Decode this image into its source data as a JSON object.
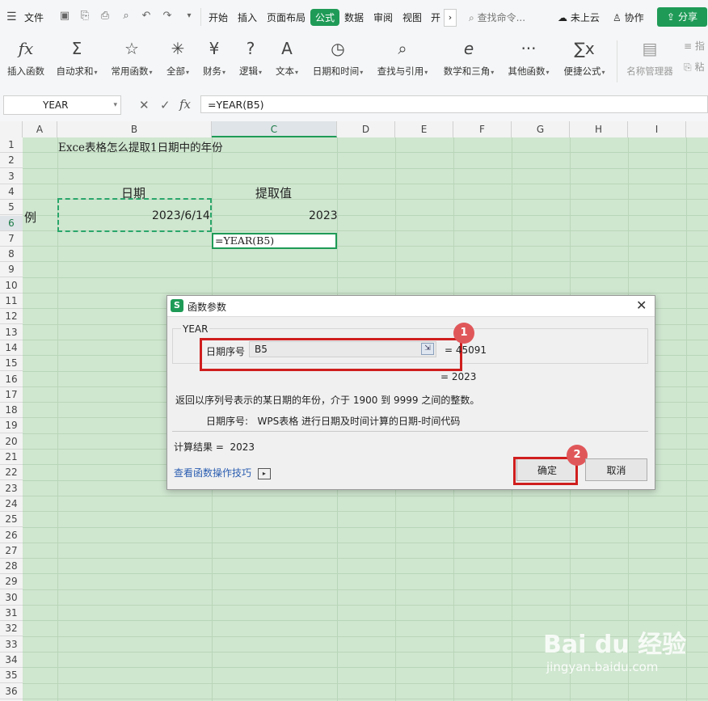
{
  "menubar": {
    "file_label": "文件",
    "tabs": [
      "开始",
      "插入",
      "页面布局",
      "公式",
      "数据",
      "审阅",
      "视图",
      "开"
    ],
    "active_tab": "公式",
    "search_placeholder": "查找命令...",
    "cloud_label": "未上云",
    "collab_label": "协作",
    "share_label": "分享"
  },
  "ribbon": {
    "buttons": [
      {
        "label": "插入函数",
        "icon": "fx"
      },
      {
        "label": "自动求和",
        "icon": "Σ"
      },
      {
        "label": "常用函数",
        "icon": "☆"
      },
      {
        "label": "全部",
        "icon": "✳"
      },
      {
        "label": "财务",
        "icon": "¥"
      },
      {
        "label": "逻辑",
        "icon": "?"
      },
      {
        "label": "文本",
        "icon": "A"
      },
      {
        "label": "日期和时间",
        "icon": "◷"
      },
      {
        "label": "查找与引用",
        "icon": "⌕"
      },
      {
        "label": "数学和三角",
        "icon": "e"
      },
      {
        "label": "其他函数",
        "icon": "···"
      },
      {
        "label": "便捷公式",
        "icon": "∑x"
      },
      {
        "label": "名称管理器",
        "icon": "▤"
      },
      {
        "label": "指",
        "icon": "≡"
      },
      {
        "label": "粘",
        "icon": "⎘"
      }
    ]
  },
  "formula_bar": {
    "name_box": "YEAR",
    "fx_label": "fx",
    "formula": "=YEAR(B5)"
  },
  "grid": {
    "columns": [
      "A",
      "B",
      "C",
      "D",
      "E",
      "F",
      "G",
      "H",
      "I"
    ],
    "selected_column": "C",
    "selected_row": "6",
    "rows": [
      "1",
      "2",
      "3",
      "4",
      "5",
      "6",
      "7",
      "8",
      "9",
      "10",
      "11",
      "12",
      "13",
      "14",
      "15",
      "16",
      "17",
      "18",
      "19",
      "20",
      "21",
      "22",
      "23",
      "24",
      "25",
      "26",
      "27",
      "28",
      "29",
      "30",
      "31",
      "32",
      "33",
      "34",
      "35",
      "36"
    ],
    "cells": {
      "b1": "Exce表格怎么提取1日期中的年份",
      "b4": "日期",
      "c4": "提取值",
      "a5": "例",
      "b5": "2023/6/14",
      "c5": "2023",
      "c6": "=YEAR(B5)"
    }
  },
  "dialog": {
    "title": "函数参数",
    "function_name": "YEAR",
    "arg_label": "日期序号",
    "arg_value": "B5",
    "arg_result": "= 45091",
    "func_result": "= 2023",
    "description": "返回以序列号表示的某日期的年份，介于 1900 到 9999 之间的整数。",
    "arg_help": "日期序号:   WPS表格 进行日期及时间计算的日期-时间代码",
    "calc_result": "计算结果 =  2023",
    "help_link": "查看函数操作技巧",
    "ok_label": "确定",
    "cancel_label": "取消",
    "badge1": "1",
    "badge2": "2"
  },
  "watermark": {
    "brand": "Bai du 经验",
    "url": "jingyan.baidu.com"
  },
  "colors": {
    "accent": "#1f9b57",
    "sheet_bg": "#cfe6cf",
    "highlight": "#d01e1e"
  }
}
